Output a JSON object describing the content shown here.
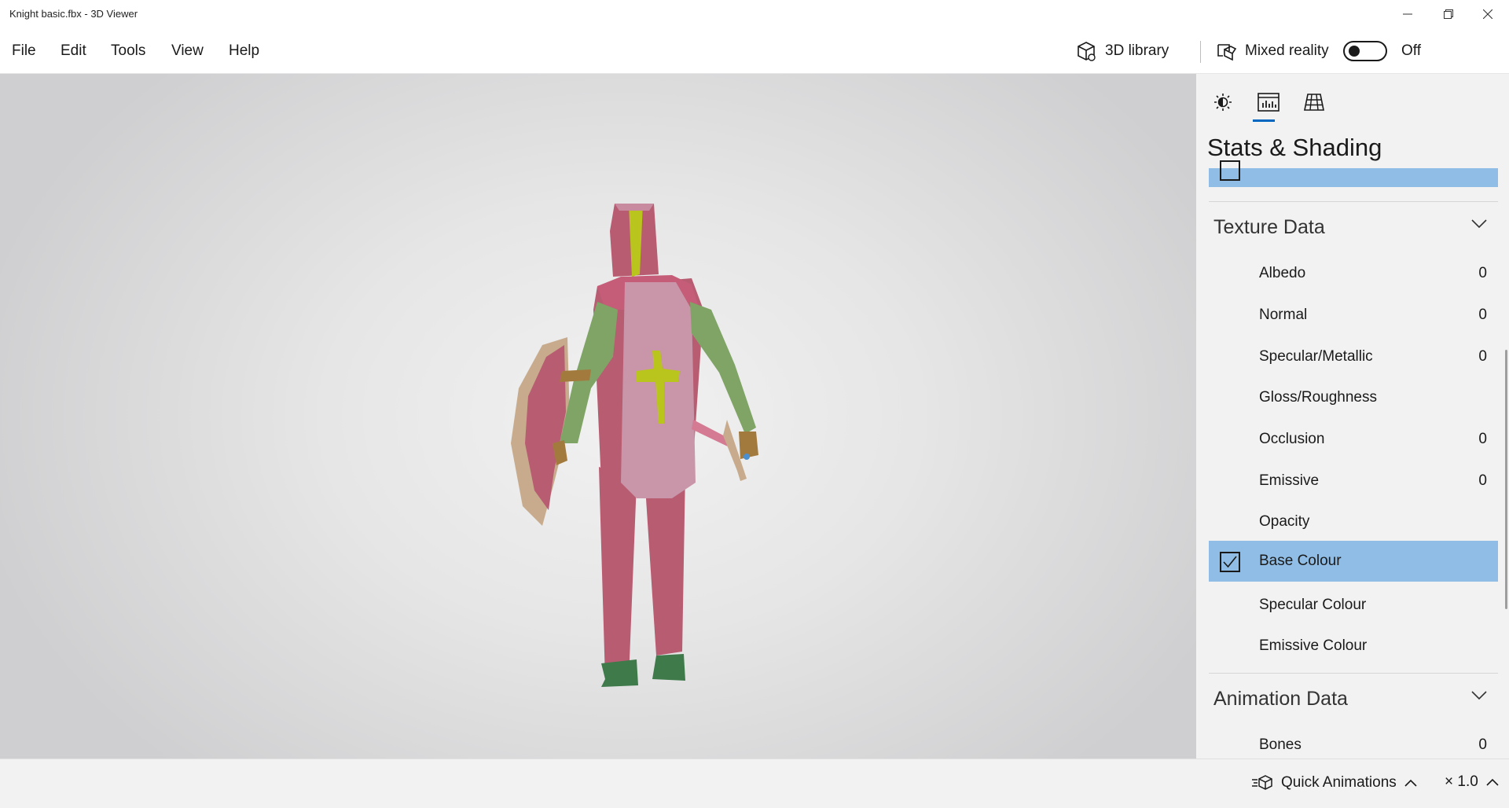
{
  "window": {
    "title": "Knight basic.fbx - 3D Viewer"
  },
  "menu": {
    "file": "File",
    "edit": "Edit",
    "tools": "Tools",
    "view": "View",
    "help": "Help"
  },
  "toolbar": {
    "library_label": "3D library",
    "mixed_reality_label": "Mixed reality",
    "mixed_reality_state": "Off"
  },
  "panel": {
    "title": "Stats & Shading",
    "tabs": [
      "lighting-icon",
      "stats-icon",
      "grid-icon"
    ],
    "active_tab": 1,
    "texture_section": {
      "title": "Texture Data",
      "items": [
        {
          "label": "Albedo",
          "value": "0"
        },
        {
          "label": "Normal",
          "value": "0"
        },
        {
          "label": "Specular/Metallic",
          "value": "0"
        },
        {
          "label": "Gloss/Roughness",
          "value": ""
        },
        {
          "label": "Occlusion",
          "value": "0"
        },
        {
          "label": "Emissive",
          "value": "0"
        },
        {
          "label": "Opacity",
          "value": ""
        },
        {
          "label": "Base Colour",
          "value": "",
          "selected": true,
          "checked": true
        },
        {
          "label": "Specular Colour",
          "value": ""
        },
        {
          "label": "Emissive Colour",
          "value": ""
        }
      ]
    },
    "animation_section": {
      "title": "Animation Data",
      "items": [
        {
          "label": "Bones",
          "value": "0"
        }
      ]
    }
  },
  "bottom": {
    "quick_animations": "Quick Animations",
    "speed": "× 1.0"
  },
  "colors": {
    "accent": "#0067c0",
    "selected_row": "#8fbde6",
    "knight_body": "#b85c72",
    "knight_tabard": "#c896a8",
    "knight_arms": "#7fa466",
    "knight_cross": "#b9c41c",
    "knight_boots": "#3e7a4a",
    "shield_rim": "#c8ab8d"
  }
}
